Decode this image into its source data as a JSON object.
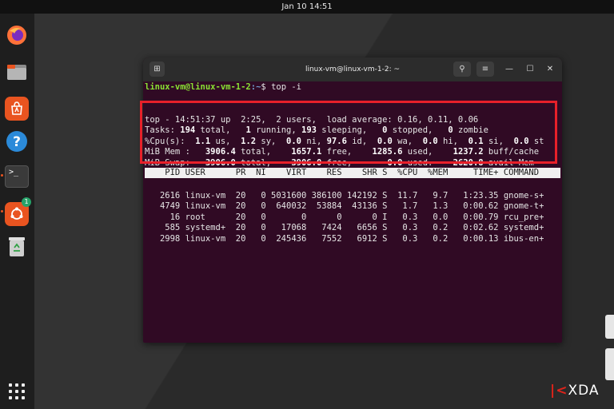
{
  "topbar": {
    "datetime": "Jan 10  14:51",
    "status_icons": "⏚ ♪ ⏻"
  },
  "dock": {
    "items": [
      {
        "name": "Firefox",
        "icon": "firefox-icon",
        "color": "#ff7139"
      },
      {
        "name": "Files",
        "icon": "folder-icon",
        "color": "#9c9c9c"
      },
      {
        "name": "App Center",
        "icon": "store-icon",
        "color": "#e95420"
      },
      {
        "name": "Help",
        "icon": "help-icon",
        "color": "#2b8ad9"
      },
      {
        "name": "Terminal",
        "icon": "terminal-icon",
        "color": "#3a3a3a"
      },
      {
        "name": "Software Updater",
        "icon": "updater-icon",
        "color": "#e95420",
        "badge": "1"
      },
      {
        "name": "Trash",
        "icon": "trash-icon",
        "color": "#cfcfcf"
      }
    ]
  },
  "terminal": {
    "title": "linux-vm@linux-vm-1-2: ~",
    "prompt_user": "linux-vm@linux-vm-1-2",
    "prompt_path": ":~",
    "prompt_symbol": "$ ",
    "command": "top -i",
    "summary": {
      "line1": "top - 14:51:37 up  2:25,  2 users,  load average: 0.16, 0.11, 0.06",
      "tasks": {
        "label": "Tasks: ",
        "total": "194",
        "t_total": " total,   ",
        "running": "1",
        "t_running": " running, ",
        "sleeping": "193",
        "t_sleeping": " sleeping,   ",
        "stopped": "0",
        "t_stopped": " stopped,   ",
        "zombie": "0",
        "t_zombie": " zombie"
      },
      "cpu": {
        "label": "%Cpu(s):  ",
        "us": "1.1",
        "t_us": " us,  ",
        "sy": "1.2",
        "t_sy": " sy,  ",
        "ni": "0.0",
        "t_ni": " ni, ",
        "id": "97.6",
        "t_id": " id,  ",
        "wa": "0.0",
        "t_wa": " wa,  ",
        "hi": "0.0",
        "t_hi": " hi,  ",
        "si": "0.1",
        "t_si": " si,  ",
        "st": "0.0",
        "t_st": " st"
      },
      "mem": {
        "label": "MiB Mem :   ",
        "total": "3906.4",
        "t_total": " total,    ",
        "free": "1657.1",
        "t_free": " free,    ",
        "used": "1285.6",
        "t_used": " used,    ",
        "cache": "1237.2",
        "t_cache": " buff/cache"
      },
      "swap": {
        "label": "MiB Swap:   ",
        "total": "3906.0",
        "t_total": " total,    ",
        "free": "3906.0",
        "t_free": " free,       ",
        "used": "0.0",
        "t_used": " used.    ",
        "avail": "2620.8",
        "t_avail": " avail Mem"
      }
    },
    "proc_header": "    PID USER      PR  NI    VIRT    RES    SHR S  %CPU  %MEM     TIME+ COMMAND  ",
    "processes": [
      "   2616 linux-vm  20   0 5031600 386100 142192 S  11.7   9.7   1:23.35 gnome-s+",
      "   4749 linux-vm  20   0  640032  53884  43136 S   1.7   1.3   0:00.62 gnome-t+",
      "     16 root      20   0       0      0      0 I   0.3   0.0   0:00.79 rcu_pre+",
      "    585 systemd+  20   0   17068   7424   6656 S   0.3   0.2   0:02.62 systemd+",
      "   2998 linux-vm  20   0  245436   7552   6912 S   0.3   0.2   0:00.13 ibus-en+"
    ]
  },
  "watermark": {
    "bracket": "|<",
    "text": "XDA"
  },
  "colors": {
    "terminal_bg": "#300a24",
    "highlight": "#e8202a",
    "accent": "#e95420"
  }
}
